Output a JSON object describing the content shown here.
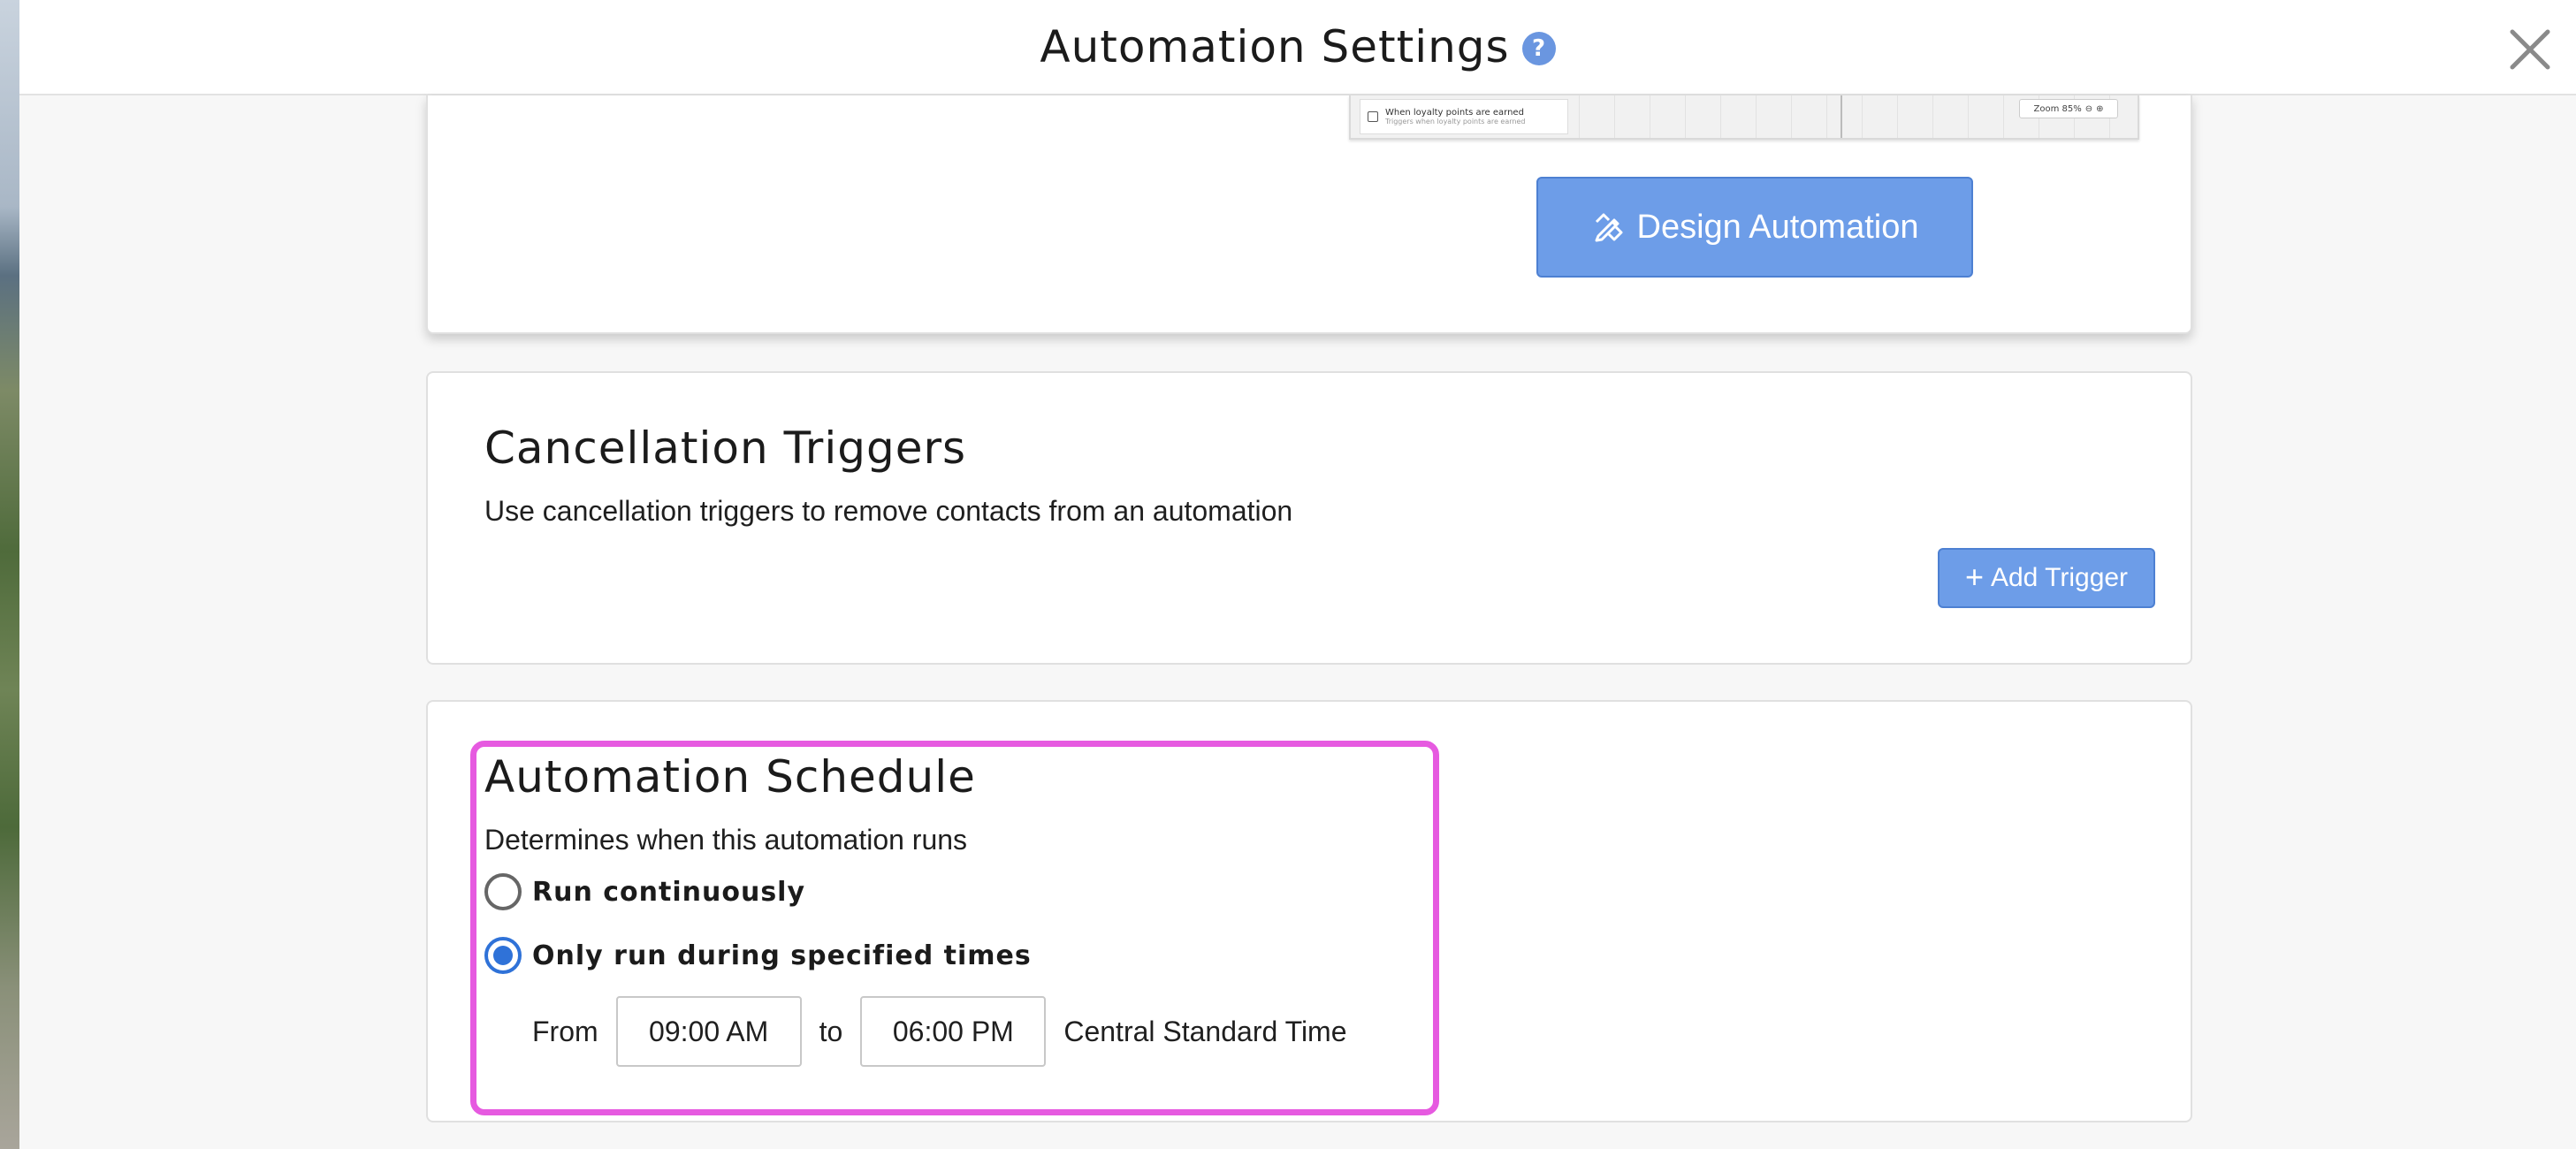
{
  "header": {
    "title": "Automation Settings",
    "help_icon": "?",
    "close_icon": "close-icon"
  },
  "design_card": {
    "preview": {
      "trigger_title": "When loyalty points are earned",
      "trigger_sub": "Triggers when loyalty points are earned",
      "zoom_label": "Zoom 85%"
    },
    "button_label": "Design Automation"
  },
  "cancellation": {
    "title": "Cancellation Triggers",
    "description": "Use cancellation triggers to remove contacts from an automation",
    "add_button": "Add Trigger"
  },
  "schedule": {
    "title": "Automation Schedule",
    "description": "Determines when this automation runs",
    "options": [
      {
        "label": "Run continuously",
        "checked": false
      },
      {
        "label": "Only run during specified times",
        "checked": true
      }
    ],
    "from_label": "From",
    "from_value": "09:00 AM",
    "to_label": "to",
    "to_value": "06:00 PM",
    "timezone": "Central Standard Time"
  },
  "colors": {
    "primary_button": "#6d9de8",
    "radio_selected": "#2f72d8",
    "highlight": "#e65ae0"
  }
}
